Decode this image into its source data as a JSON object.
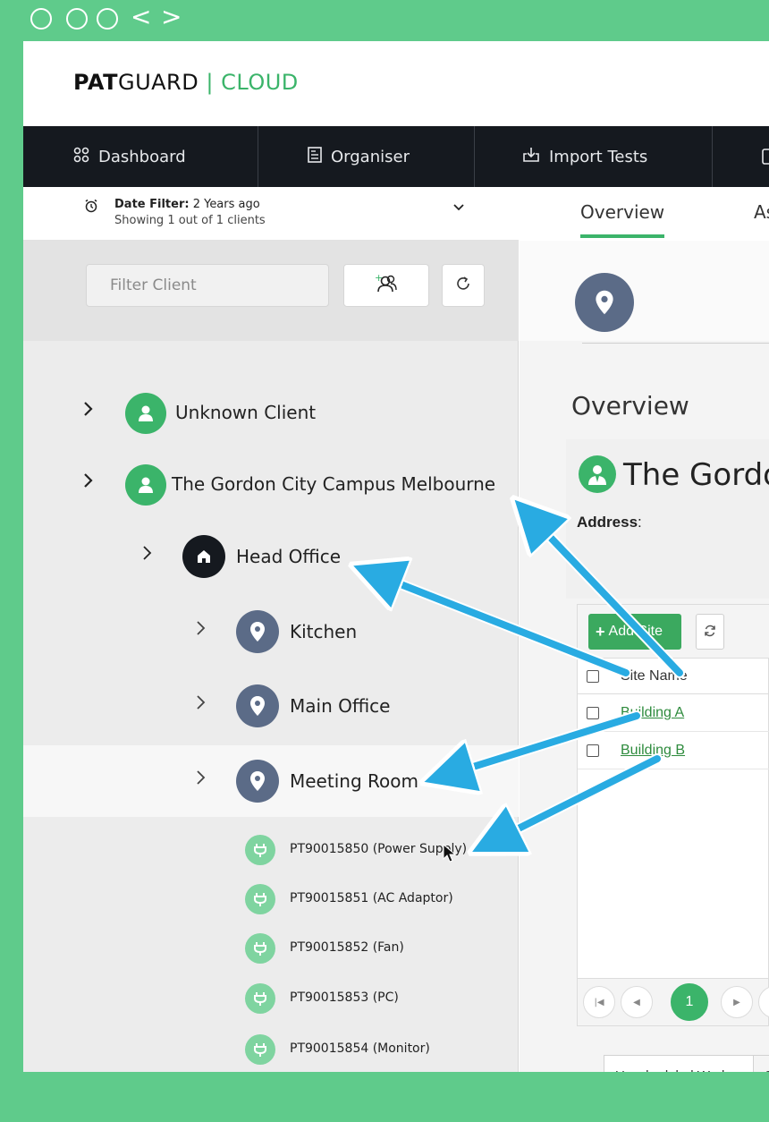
{
  "window_controls": {
    "back": "<",
    "forward": ">"
  },
  "brand": {
    "strong": "PAT",
    "rest": "GUARD",
    "sep": " | ",
    "cloud": "CLOUD"
  },
  "nav": [
    {
      "label": "Dashboard",
      "icon": "grid-icon"
    },
    {
      "label": "Organiser",
      "icon": "organiser-icon"
    },
    {
      "label": "Import Tests",
      "icon": "import-icon"
    }
  ],
  "date_filter": {
    "label": "Date Filter:",
    "value": " 2 Years ago",
    "showing": "Showing 1 out of 1 clients"
  },
  "filter": {
    "placeholder": "Filter Client"
  },
  "tree": {
    "clients": [
      {
        "label": "Unknown Client",
        "color": "#3bb46a"
      },
      {
        "label": "The Gordon City Campus Melbourne",
        "color": "#3bb46a"
      }
    ],
    "site": {
      "label": "Head Office",
      "color": "#15191f"
    },
    "locations": [
      {
        "label": "Kitchen"
      },
      {
        "label": "Main Office"
      },
      {
        "label": "Meeting Room"
      }
    ],
    "location_color": "#5b6b87",
    "assets": [
      "PT90015850 (Power Supply)",
      "PT90015851 (AC Adaptor)",
      "PT90015852 (Fan)",
      "PT90015853 (PC)",
      "PT90015854 (Monitor)"
    ],
    "asset_color": "#7fd4a0"
  },
  "tabs": {
    "overview": "Overview",
    "second": "As"
  },
  "overview": {
    "title": "Overview",
    "client_name": "The Gordo",
    "address_label": "Address",
    "address_colon": ":"
  },
  "grid": {
    "add_site": "Add Site",
    "column": "Site Name",
    "rows": [
      "Building A",
      "Building B"
    ]
  },
  "pager": {
    "current": "1"
  },
  "bottom_tabs": [
    "Unscheduled Work",
    "Sche"
  ],
  "colors": {
    "accent": "#3bb46a",
    "frame": "#5fcb8b",
    "nav": "#15191f",
    "annotation": "#29abe2"
  }
}
